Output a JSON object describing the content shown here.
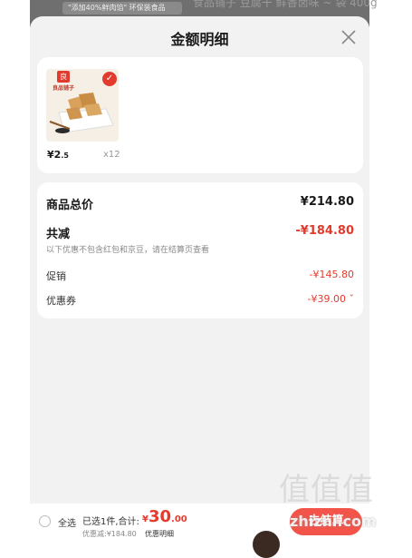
{
  "background_bar": {
    "promo_strip": "\"添加40%鲜肉馅\" 环保装食品",
    "partial_title": "食品铺子 豆腐干 鲜香卤味 ~ 袋 400g"
  },
  "sheet": {
    "title": "金额明细"
  },
  "product": {
    "brand_badge": "良",
    "brand_name": "良品铺子",
    "price_int": "¥2",
    "price_dec": ".5",
    "quantity": "x12"
  },
  "summary": {
    "total_label": "商品总价",
    "total_value": "¥214.80",
    "reduce_label": "共减",
    "reduce_value": "-¥184.80",
    "note": "以下优惠不包含红包和京豆，请在结算页查看",
    "promo_label": "促销",
    "promo_value": "-¥145.80",
    "coupon_label": "优惠券",
    "coupon_value": "-¥39.00"
  },
  "bottom_bar": {
    "select_all": "全选",
    "selected_info": "已选1件,合计:",
    "amount_currency": "¥",
    "amount_int": "30",
    "amount_dec": ".00",
    "discount_note": "优惠减:¥184.80",
    "detail_link": "优惠明细",
    "checkout": "去结算"
  },
  "watermark": {
    "logo": "值值值",
    "site": "zhizhi.com"
  },
  "colors": {
    "accent": "#e23b2e",
    "checkout": "#f2544a"
  }
}
